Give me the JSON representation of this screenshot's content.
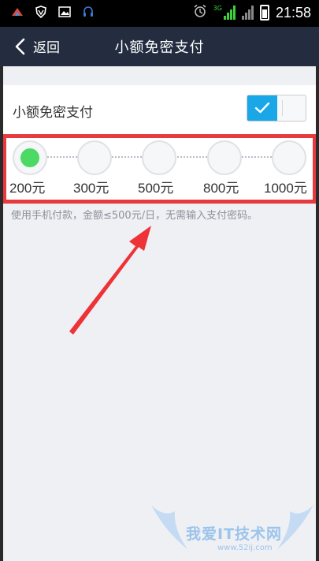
{
  "status_bar": {
    "time": "21:58",
    "network": "3G",
    "icons": [
      "app-icon",
      "shield-icon",
      "image-icon",
      "headset-icon",
      "alarm-icon",
      "signal-icon",
      "battery-icon"
    ]
  },
  "nav": {
    "back_label": "返回",
    "title": "小额免密支付"
  },
  "setting": {
    "label": "小额免密支付",
    "toggle_on": true,
    "accent_color": "#1aa7e8"
  },
  "limit_slider": {
    "options": [
      "200元",
      "300元",
      "500元",
      "800元",
      "1000元"
    ],
    "selected_index": 0,
    "selected_color": "#4cd964"
  },
  "description": "使用手机付款，金额≤500元/日，无需输入支付密码。",
  "highlight_color": "#e63a3f",
  "watermark": {
    "text": "我爱IT技术网",
    "url": "www.52ij.com"
  }
}
